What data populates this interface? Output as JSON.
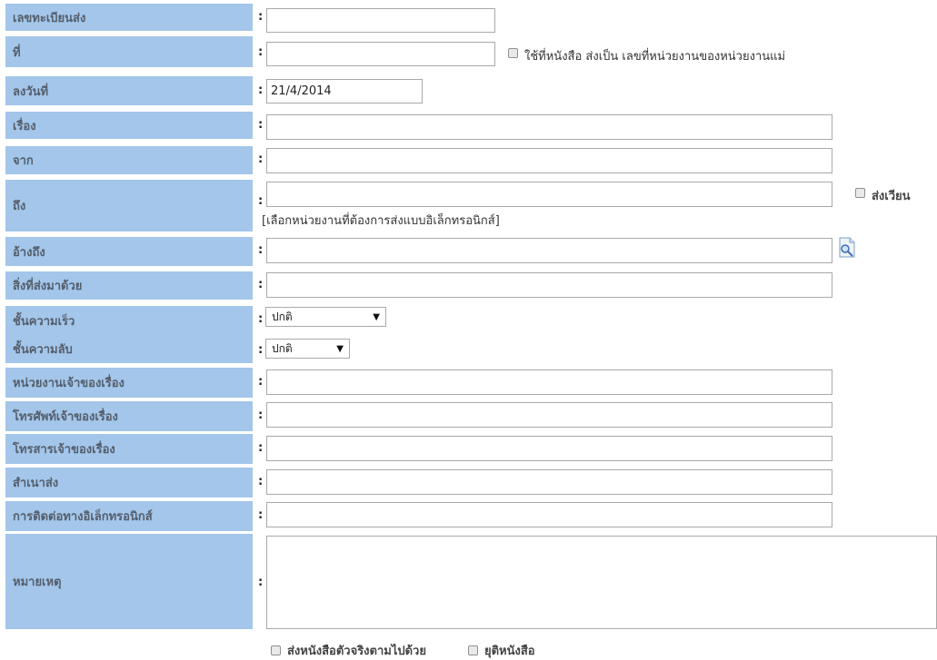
{
  "fields": {
    "reg_no": {
      "label": "เลขทะเบียนส่ง",
      "value": ""
    },
    "doc_no": {
      "label": "ที่",
      "value": "",
      "checkbox_label": "ใช้ที่หนังสือ  ส่งเป็น เลขที่หน่วยงานของหน่วยงานแม่"
    },
    "date": {
      "label": "ลงวันที่",
      "value": "21/4/2014"
    },
    "subject": {
      "label": "เรื่อง",
      "value": ""
    },
    "from": {
      "label": "จาก",
      "value": ""
    },
    "to": {
      "label": "ถึง",
      "value": "",
      "checkbox_label": "ส่งเวียน",
      "hint": "[เลือกหน่วยงานที่ต้องการส่งแบบอิเล็กทรอนิกส์]"
    },
    "reference": {
      "label": "อ้างถึง",
      "value": ""
    },
    "attachments": {
      "label": "สิ่งที่ส่งมาด้วย",
      "value": ""
    },
    "urgency": {
      "label": "ชั้นความเร็ว",
      "selected": "ปกติ"
    },
    "secrecy": {
      "label": "ชั้นความลับ",
      "selected": "ปกติ"
    },
    "owner_unit": {
      "label": "หน่วยงานเจ้าของเรื่อง",
      "value": ""
    },
    "owner_phone": {
      "label": "โทรศัพท์เจ้าของเรื่อง",
      "value": ""
    },
    "owner_fax": {
      "label": "โทรสารเจ้าของเรื่อง",
      "value": ""
    },
    "copy_to": {
      "label": "สำเนาส่ง",
      "value": ""
    },
    "electronic_contact": {
      "label": "การติดต่อทางอิเล็กทรอนิกส์",
      "value": ""
    },
    "remarks": {
      "label": "หมายเหตุ",
      "value": ""
    }
  },
  "colon": ":",
  "footer": {
    "send_original_label": "ส่งหนังสือตัวจริงตามไปด้วย",
    "terminate_label": "ยุติหนังสือ"
  },
  "icons": {
    "reference_lookup": "magnifier-document-icon"
  }
}
